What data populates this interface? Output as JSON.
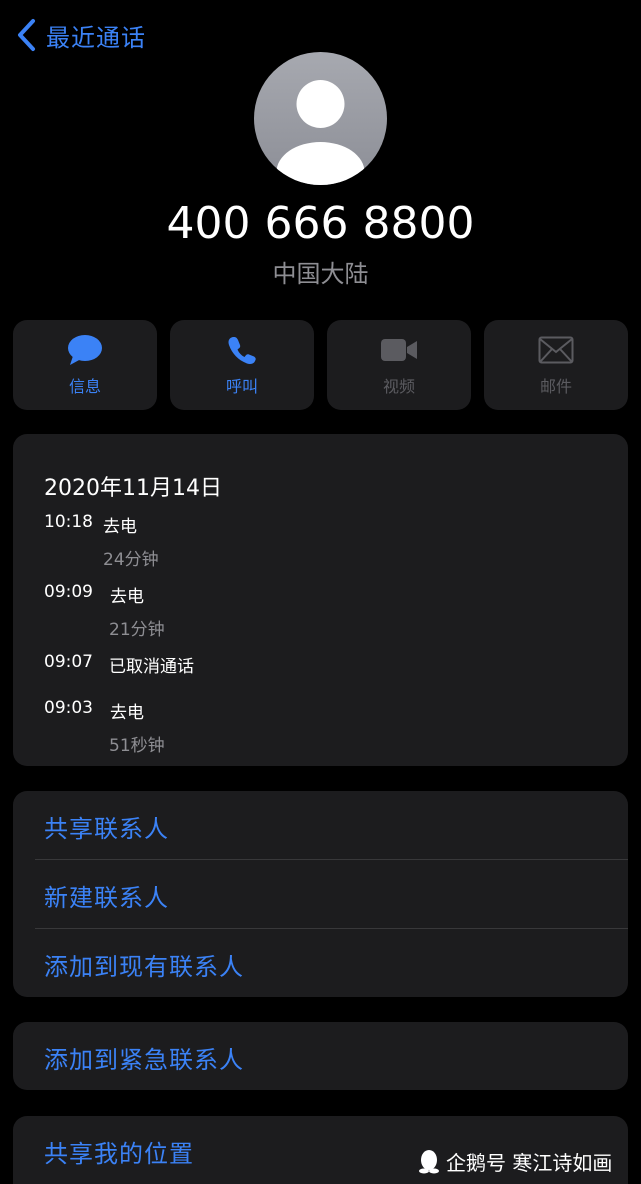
{
  "nav": {
    "back_label": "最近通话"
  },
  "contact": {
    "number": "400 666 8800",
    "region": "中国大陆"
  },
  "actions": [
    {
      "label": "信息",
      "icon": "message-icon",
      "enabled": true
    },
    {
      "label": "呼叫",
      "icon": "phone-icon",
      "enabled": true
    },
    {
      "label": "视频",
      "icon": "video-icon",
      "enabled": false
    },
    {
      "label": "邮件",
      "icon": "mail-icon",
      "enabled": false
    }
  ],
  "calls": {
    "date": "2020年11月14日",
    "entries": [
      {
        "time": "10:18",
        "type": "去电",
        "duration": "24分钟"
      },
      {
        "time": "09:09",
        "type": "去电",
        "duration": "21分钟"
      },
      {
        "time": "09:07",
        "type": "已取消通话",
        "duration": ""
      },
      {
        "time": "09:03",
        "type": "去电",
        "duration": "51秒钟"
      }
    ]
  },
  "menu": {
    "share_contact": "共享联系人",
    "new_contact": "新建联系人",
    "add_existing": "添加到现有联系人",
    "add_emergency": "添加到紧急联系人",
    "share_location": "共享我的位置"
  },
  "watermark": {
    "text": "企鹅号 寒江诗如画"
  },
  "colors": {
    "accent": "#3b82f6",
    "background": "#000000",
    "card": "#1c1c1e",
    "secondary_text": "#8e8e93",
    "disabled": "#5b5b60"
  }
}
